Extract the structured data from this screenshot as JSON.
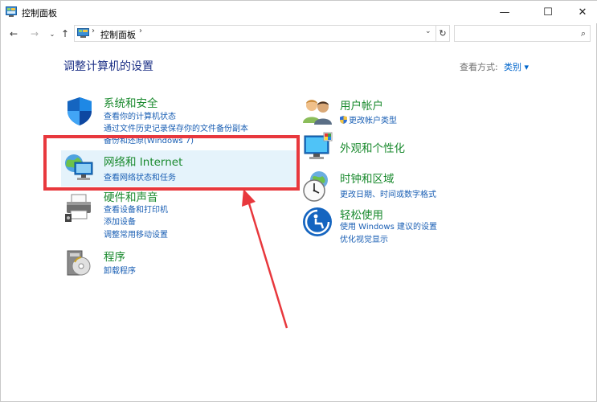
{
  "window": {
    "title": "控制面板",
    "minimize_glyph": "—",
    "maximize_glyph": "☐",
    "close_glyph": "✕"
  },
  "navbar": {
    "back_glyph": "←",
    "forward_glyph": "→",
    "recent_glyph": "⌄",
    "up_glyph": "↑",
    "address_sep": "›",
    "address_text": "控制面板",
    "address_dropdown": "⌄",
    "refresh_glyph": "↻",
    "search_placeholder": "",
    "search_glyph": "⌕"
  },
  "main": {
    "title": "调整计算机的设置",
    "view_label": "查看方式:",
    "view_value": "类别 ▾"
  },
  "left_categories": [
    {
      "icon": "shield-icon",
      "title": "系统和安全",
      "links": [
        "查看你的计算机状态",
        "通过文件历史记录保存你的文件备份副本",
        "备份和还原(Windows 7)"
      ]
    },
    {
      "icon": "network-icon",
      "title": "网络和 Internet",
      "links": [
        "查看网络状态和任务"
      ]
    },
    {
      "icon": "printer-icon",
      "title": "硬件和声音",
      "links": [
        "查看设备和打印机",
        "添加设备",
        "调整常用移动设置"
      ]
    },
    {
      "icon": "programs-icon",
      "title": "程序",
      "links": [
        "卸载程序"
      ]
    }
  ],
  "right_categories": [
    {
      "icon": "users-icon",
      "title": "用户帐户",
      "links": [
        "更改帐户类型"
      ]
    },
    {
      "icon": "appearance-icon",
      "title": "外观和个性化",
      "links": []
    },
    {
      "icon": "clock-icon",
      "title": "时钟和区域",
      "links": [
        "更改日期、时间或数字格式"
      ]
    },
    {
      "icon": "ease-of-access-icon",
      "title": "轻松使用",
      "links": [
        "使用 Windows 建议的设置",
        "优化视觉显示"
      ]
    }
  ],
  "annotation_color": "#e8383d"
}
